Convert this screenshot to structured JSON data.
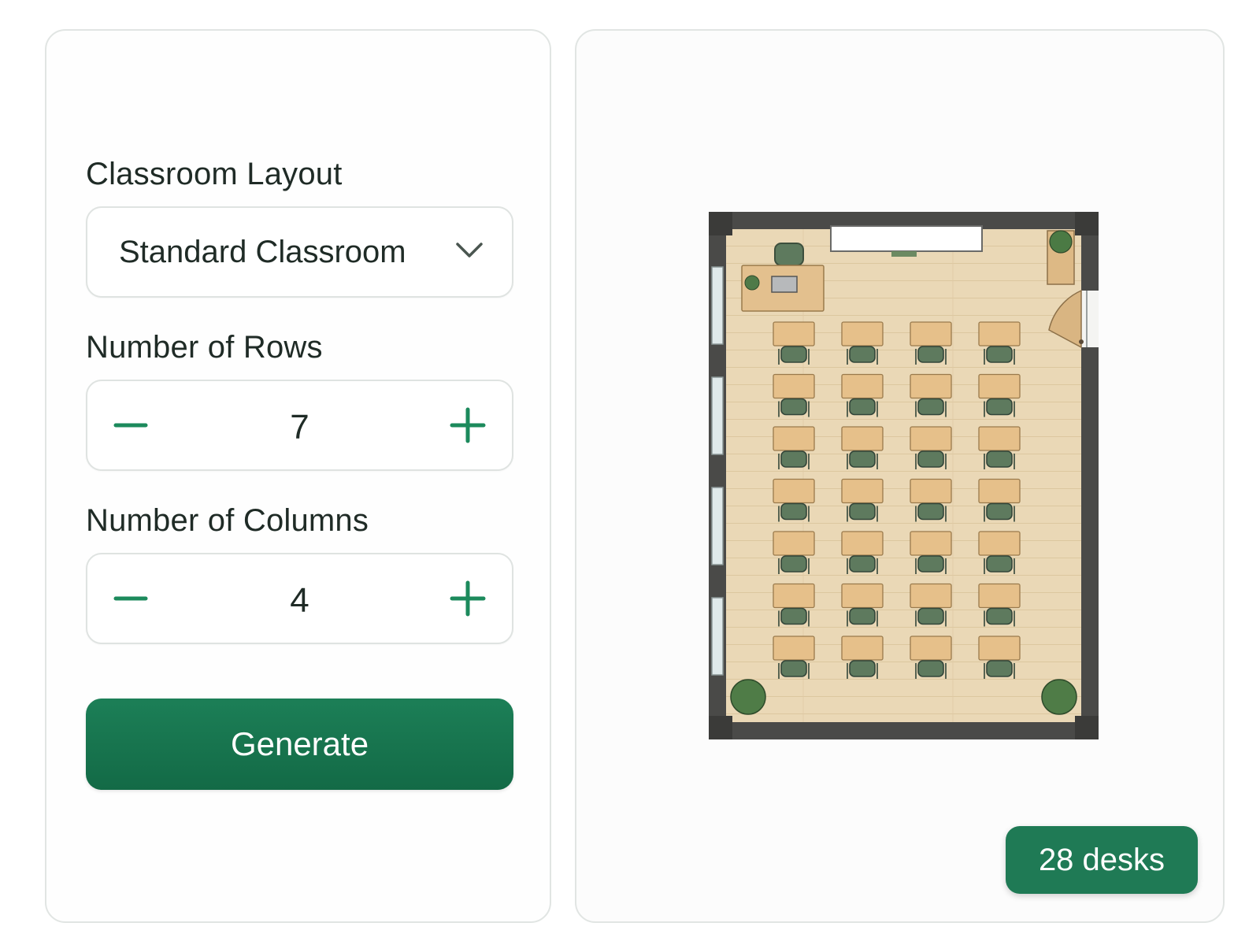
{
  "controls": {
    "layout": {
      "label": "Classroom Layout",
      "value": "Standard Classroom"
    },
    "rows": {
      "label": "Number of Rows",
      "value": 7
    },
    "columns": {
      "label": "Number of Columns",
      "value": 4
    },
    "generate_label": "Generate"
  },
  "preview": {
    "desk_count_label": "28 desks"
  },
  "colors": {
    "accent": "#1c7a52",
    "floor": "#e8d6b4",
    "wall": "#4a4a48",
    "desk": "#e6c08a",
    "chair": "#5e7a5e"
  },
  "icons": [
    "chevron-down-icon",
    "minus-icon",
    "plus-icon",
    "plant-icon",
    "door-icon",
    "laptop-icon"
  ]
}
